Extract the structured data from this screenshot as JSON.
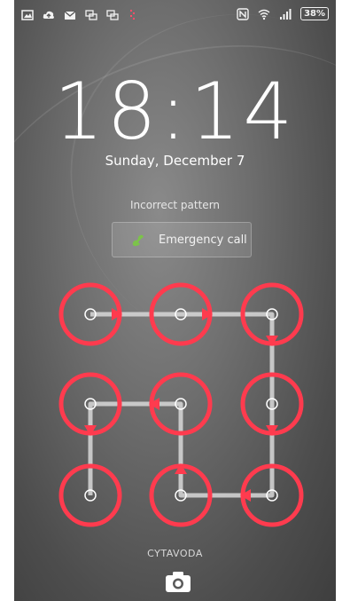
{
  "status_bar": {
    "left_icons": [
      "image-icon",
      "cloud-upload-icon",
      "gmail-icon",
      "screen-mirror-icon",
      "screen-mirror-icon-2",
      "sim-icon"
    ],
    "right_icons": [
      "nfc-icon",
      "wifi-icon",
      "signal-icon"
    ],
    "battery": "38%"
  },
  "lock": {
    "time": "18:14",
    "date": "Sunday, December 7",
    "status_message": "Incorrect pattern"
  },
  "emergency": {
    "label": "Emergency call"
  },
  "carrier": "CYTAVODA",
  "colors": {
    "error_red": "#ff3b4e",
    "pattern_line": "#d8d8d8",
    "phone_accent": "#7cc34a"
  },
  "pattern": {
    "rows": 3,
    "cols": 3,
    "state": "wrong",
    "sequence": [
      1,
      2,
      3,
      6,
      9,
      8,
      5,
      4,
      7
    ]
  }
}
